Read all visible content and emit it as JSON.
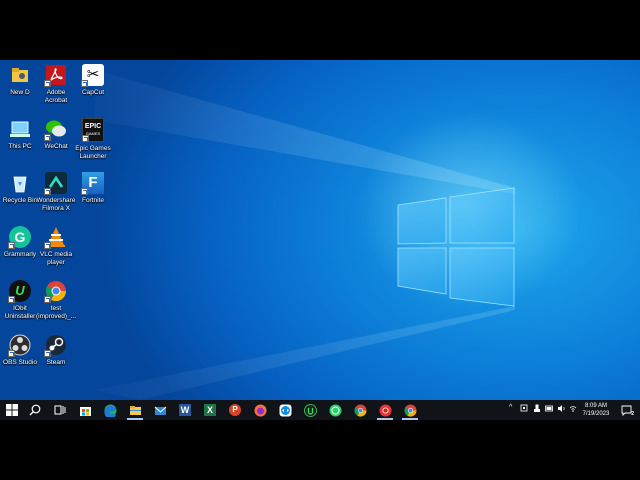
{
  "desktop_icons": [
    {
      "name": "icon-new-d",
      "label": "New D"
    },
    {
      "name": "icon-adobe-acrobat",
      "label": "Adobe Acrobat"
    },
    {
      "name": "icon-capcut",
      "label": "CapCut"
    },
    {
      "name": "icon-this-pc",
      "label": "This PC"
    },
    {
      "name": "icon-wechat",
      "label": "WeChat"
    },
    {
      "name": "icon-epic-games",
      "label": "Epic Games Launcher"
    },
    {
      "name": "icon-recycle-bin",
      "label": "Recycle Bin"
    },
    {
      "name": "icon-wondershare",
      "label": "Wondershare Filmora X"
    },
    {
      "name": "icon-fortnite",
      "label": "Fortnite"
    },
    {
      "name": "icon-grammarly",
      "label": "Grammarly"
    },
    {
      "name": "icon-vlc",
      "label": "VLC media player"
    },
    {
      "name": "icon-iobit",
      "label": "IObit Uninstaller"
    },
    {
      "name": "icon-chrome-file",
      "label": "test (improved)_..."
    },
    {
      "name": "icon-obs",
      "label": "OBS Studio"
    },
    {
      "name": "icon-steam",
      "label": "Steam"
    }
  ],
  "icon_text": {
    "epic": "EPIC",
    "epic_sub": "GAMES",
    "capcut_glyph": "✂",
    "fortnite_glyph": "F",
    "grammarly_glyph": "G",
    "iobit_glyph": "U"
  },
  "taskbar": {
    "apps": [
      "start-button",
      "search-button",
      "task-view-button",
      "store",
      "edge",
      "file-explorer",
      "mail",
      "word",
      "excel",
      "powerpoint",
      "firefox",
      "teamviewer",
      "iobit",
      "whatsapp",
      "chrome",
      "chrome-red",
      "chrome-active"
    ],
    "word_letter": "W",
    "excel_letter": "X",
    "ppt_letter": "P"
  },
  "tray": {
    "chevron": "^",
    "notifications_count": "2"
  },
  "clock": {
    "time": "8:09 AM",
    "date": "7/19/2023"
  },
  "colors": {
    "taskbar": "#101418",
    "desktop": "#0d7fd8"
  }
}
